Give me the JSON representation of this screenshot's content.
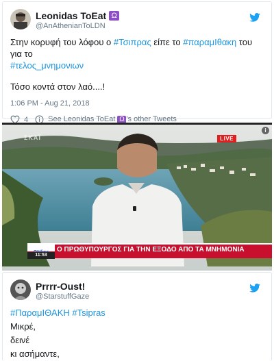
{
  "tweet1": {
    "display_name": "Leonidas ToEat",
    "badge": "Ω",
    "handle": "@AnAthenianToLDN",
    "text_intro": "Στην κορυφή του λόφου ο ",
    "hashtag1": "#Τσιπρας",
    "text_mid": " είπε το ",
    "hashtag2": "#παραμΙθακη",
    "text_end": " του για το",
    "hashtag3": "#τελος_μνημονιων",
    "line2": "Τόσο κοντά στον λαό....!",
    "timestamp": "1:06 PM - Aug 21, 2018",
    "likes": "4",
    "other_tweets_prefix": "See Leonidas ToEat",
    "other_tweets_suffix": "'s other Tweets"
  },
  "video": {
    "channel_watermark": "ΣΚΑΪ",
    "live_label": "LIVE",
    "info_icon": "i",
    "station_logo": "ONline",
    "time": "11:53",
    "ticker_text": "Ο ΠΡΩΘΥΠΟΥΡΓΟΣ ΓΙΑ ΤΗΝ ΕΞΟΔΟ ΑΠΟ ΤΑ ΜΝΗΜΟΝΙΑ"
  },
  "tweet2": {
    "display_name": "Prrrr-Oust!",
    "handle": "@StarstuffGaze",
    "hashtag1": "#ΠαραμΙΘΑΚΗ",
    "hashtag2": "#Tsipras",
    "lines": [
      "Μικρέ,",
      "δεινέ",
      "κι ασήμαντε,"
    ]
  },
  "colors": {
    "link": "#1b95e0",
    "twitter_blue": "#1da1f2",
    "badge_purple": "#8e4fc6",
    "live_red": "#e02020",
    "ticker_red": "#c8102e"
  }
}
